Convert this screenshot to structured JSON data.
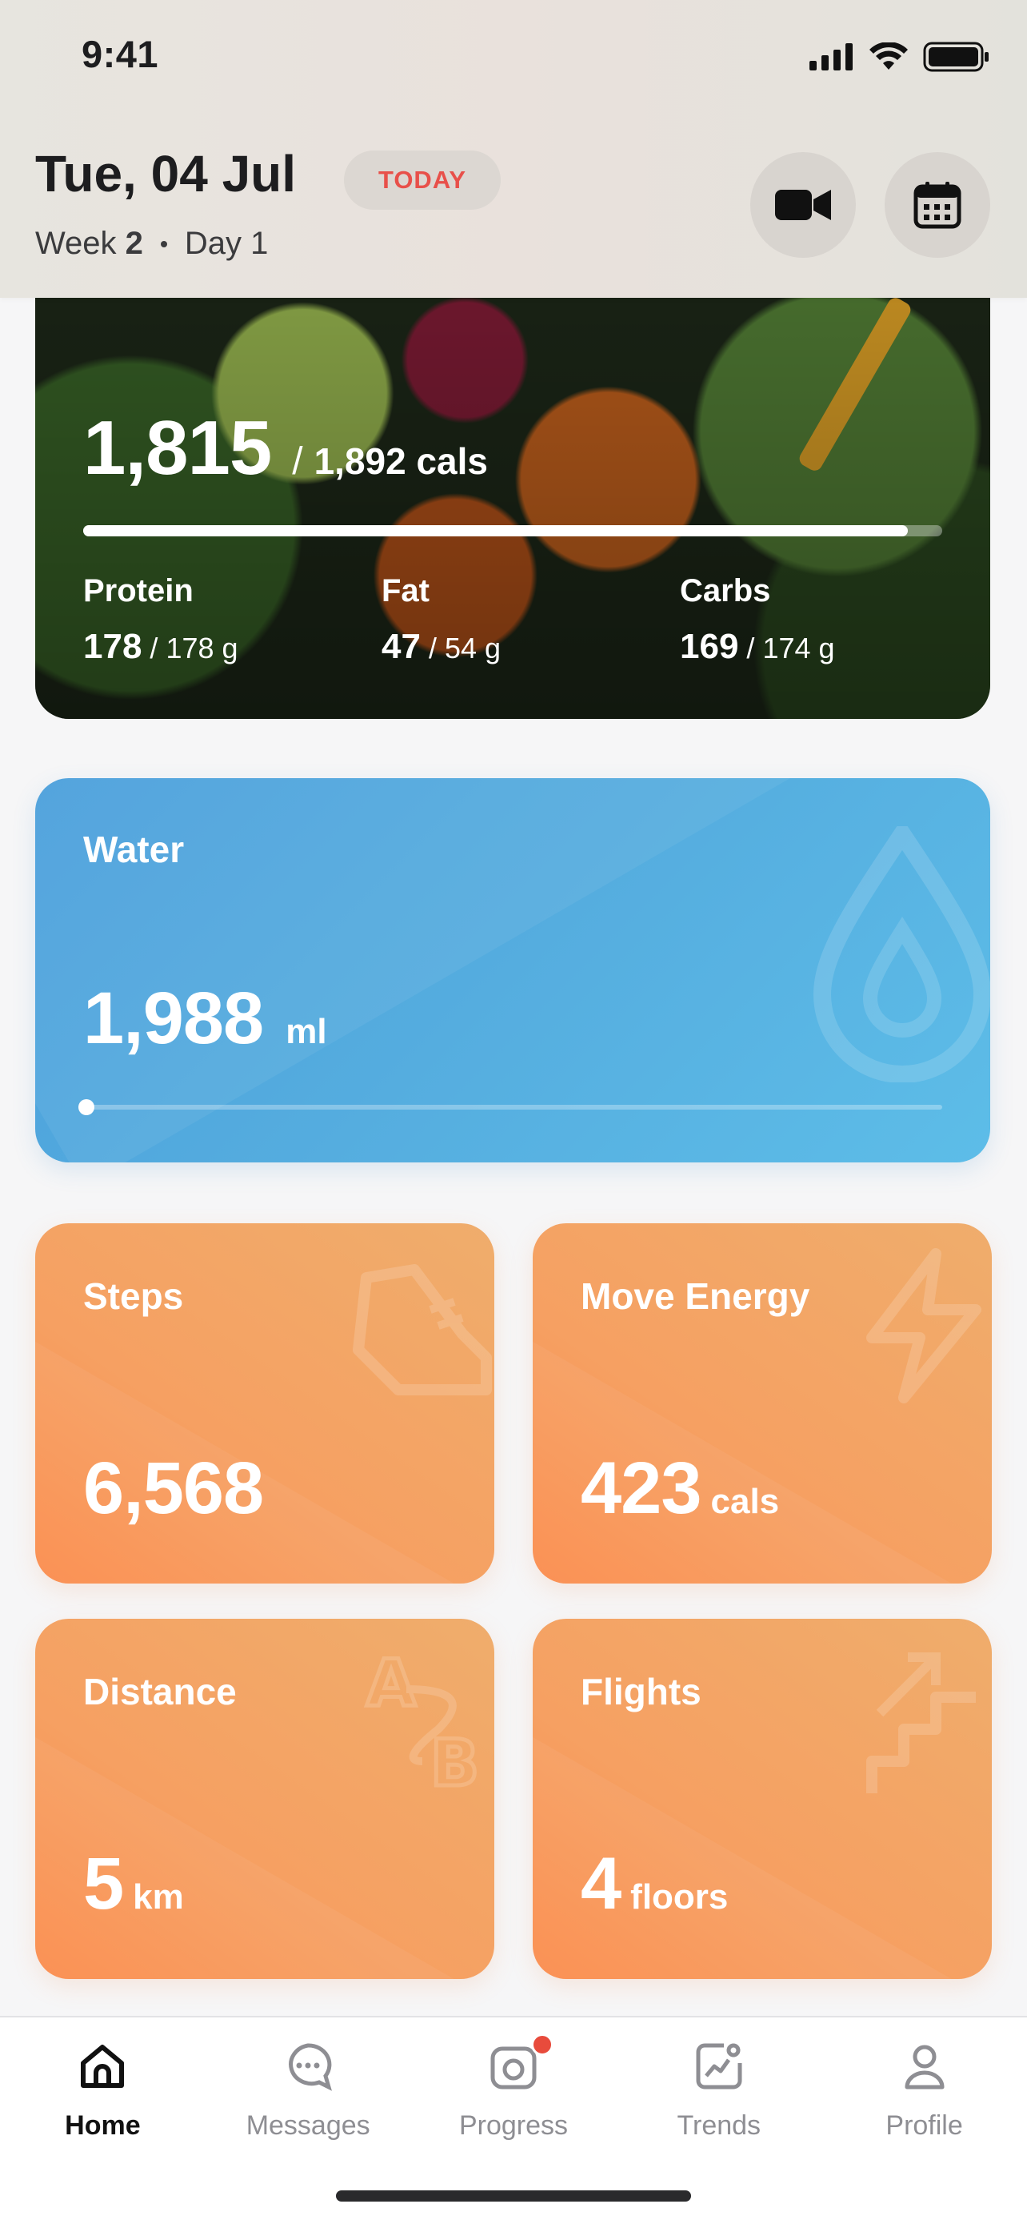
{
  "status_bar": {
    "time": "9:41"
  },
  "header": {
    "date": "Tue, 04 Jul",
    "today_badge": "TODAY",
    "week_label": "Week",
    "week_number": "2",
    "day_label": "Day 1"
  },
  "nutrition": {
    "calories_eaten": "1,815",
    "calories_target": "1,892 cals",
    "progress_fraction": 0.96,
    "macros": [
      {
        "name": "Protein",
        "value": "178",
        "target": "178 g"
      },
      {
        "name": "Fat",
        "value": "47",
        "target": "54 g"
      },
      {
        "name": "Carbs",
        "value": "169",
        "target": "174 g"
      }
    ]
  },
  "water": {
    "title": "Water",
    "value": "1,988",
    "unit": "ml",
    "progress_fraction": 0.0
  },
  "tiles": [
    {
      "title": "Steps",
      "value": "6,568",
      "unit": ""
    },
    {
      "title": "Move Energy",
      "value": "423",
      "unit": "cals"
    },
    {
      "title": "Distance",
      "value": "5",
      "unit": "km"
    },
    {
      "title": "Flights",
      "value": "4",
      "unit": "floors"
    }
  ],
  "tabbar": {
    "active": "Home",
    "items": [
      {
        "label": "Home",
        "icon": "home-icon"
      },
      {
        "label": "Messages",
        "icon": "chat-bubble-icon"
      },
      {
        "label": "Progress",
        "icon": "camera-icon"
      },
      {
        "label": "Trends",
        "icon": "trend-chart-icon"
      },
      {
        "label": "Profile",
        "icon": "user-icon"
      }
    ]
  },
  "colors": {
    "water": "#55addf",
    "activity": "#f6a062",
    "badge_text": "#e8504a",
    "notification_dot": "#e84b3c"
  }
}
